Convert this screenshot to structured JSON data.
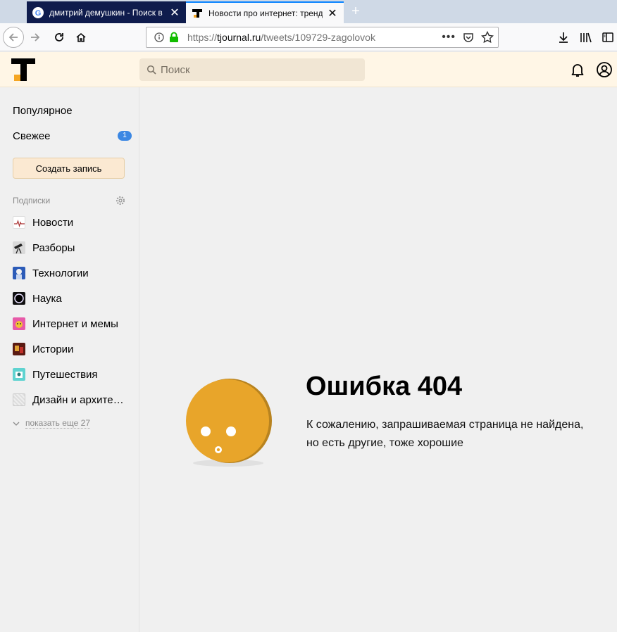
{
  "browser": {
    "tabs": [
      {
        "title": "дмитрий демушкин - Поиск в Google",
        "active": false
      },
      {
        "title": "Новости про интернет: тренды",
        "active": true
      }
    ],
    "url": {
      "scheme": "https://",
      "host": "tjournal.ru",
      "path": "/tweets/109729-zagolovok"
    }
  },
  "header": {
    "search_placeholder": "Поиск"
  },
  "sidebar": {
    "popular": "Популярное",
    "fresh": "Свежее",
    "fresh_badge": "1",
    "create_button": "Создать запись",
    "subscriptions_label": "Подписки",
    "subscriptions": [
      {
        "label": "Новости",
        "icon": "news-icon"
      },
      {
        "label": "Разборы",
        "icon": "telescope-icon"
      },
      {
        "label": "Технологии",
        "icon": "tech-icon"
      },
      {
        "label": "Наука",
        "icon": "science-icon"
      },
      {
        "label": "Интернет и мемы",
        "icon": "memes-icon"
      },
      {
        "label": "Истории",
        "icon": "stories-icon"
      },
      {
        "label": "Путешествия",
        "icon": "travel-icon"
      },
      {
        "label": "Дизайн и архите…",
        "icon": "design-icon"
      }
    ],
    "show_more": "показать еще 27"
  },
  "error": {
    "title": "Ошибка 404",
    "line1": "К сожалению, запрашиваемая страница не найдена,",
    "line2": "но есть другие, тоже хорошие"
  },
  "colors": {
    "header_bg": "#fff6e6",
    "badge": "#3b87e3",
    "mascot": "#e8a52a",
    "tab_active_accent": "#0a84ff"
  }
}
